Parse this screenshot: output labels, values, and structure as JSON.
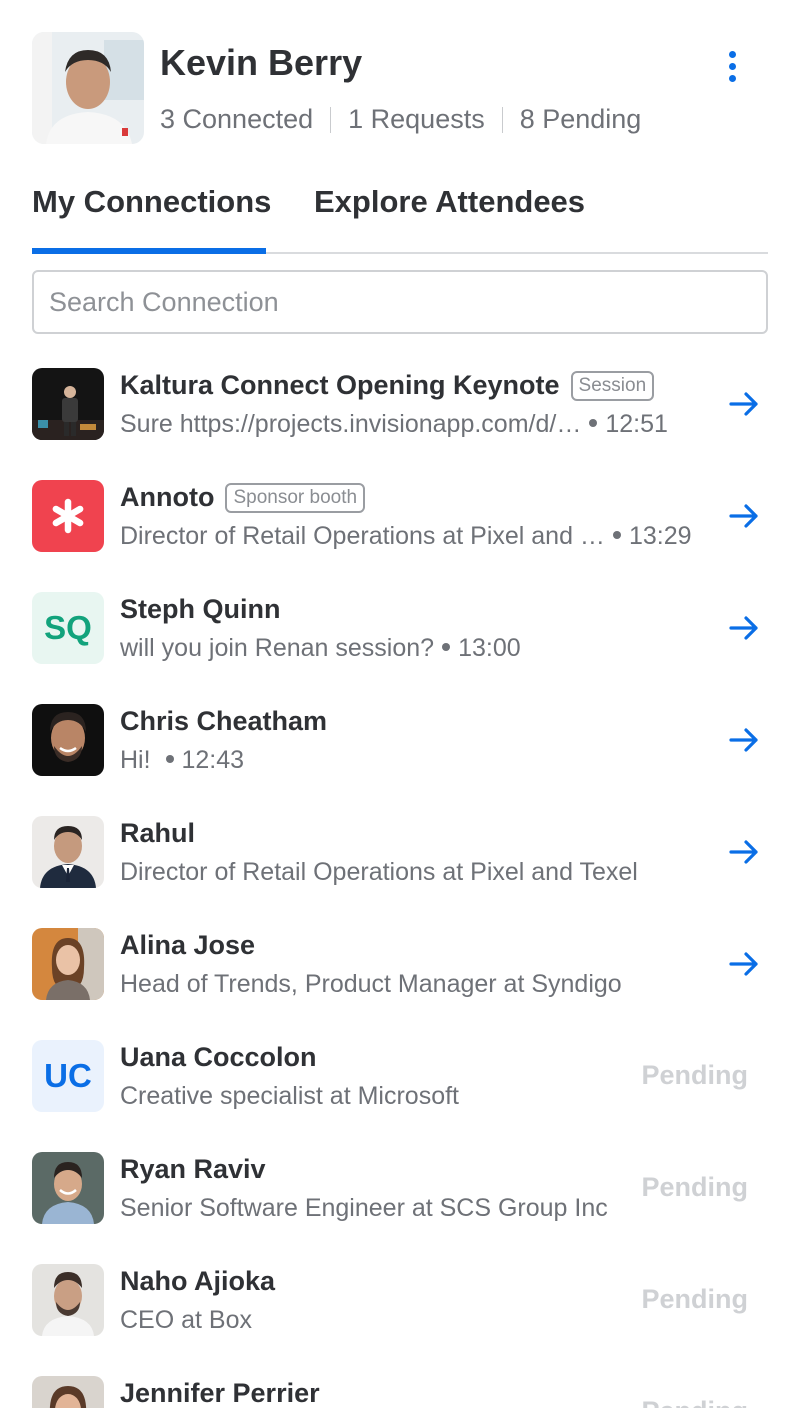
{
  "profile": {
    "name": "Kevin Berry",
    "stats": [
      "3 Connected",
      "1 Requests",
      "8 Pending"
    ]
  },
  "tabs": {
    "items": [
      "My Connections",
      "Explore Attendees"
    ],
    "active": "My Connections"
  },
  "search": {
    "placeholder": "Search Connection",
    "value": ""
  },
  "colors": {
    "accent": "#0a6ee6",
    "text": "#2f3135",
    "muted": "#6e7177",
    "pending": "#cfd1d4"
  },
  "connections": [
    {
      "name": "Kaltura Connect Opening Keynote",
      "badge": "Session",
      "subtitle": "Sure https://projects.invisionapp.com/d/…",
      "time": "12:51",
      "action": "arrow",
      "avatar": "keynote-photo"
    },
    {
      "name": "Annoto",
      "badge": "Sponsor booth",
      "subtitle": "Director of Retail Operations at Pixel and …",
      "time": "13:29",
      "action": "arrow",
      "avatar": "asterisk-logo"
    },
    {
      "name": "Steph Quinn",
      "badge": "",
      "subtitle": "will you join Renan session?",
      "time": "13:00",
      "action": "arrow",
      "initials": "SQ"
    },
    {
      "name": "Chris Cheatham",
      "badge": "",
      "subtitle": "Hi! ",
      "time": "12:43",
      "action": "arrow",
      "avatar": "person-photo"
    },
    {
      "name": "Rahul",
      "badge": "",
      "subtitle": "Director of Retail Operations at Pixel and Texel",
      "time": "",
      "action": "arrow",
      "avatar": "person-photo"
    },
    {
      "name": "Alina Jose",
      "badge": "",
      "subtitle": "Head of Trends, Product Manager at Syndigo",
      "time": "",
      "action": "arrow",
      "avatar": "person-photo"
    },
    {
      "name": "Uana Coccolon",
      "badge": "",
      "subtitle": "Creative specialist at Microsoft",
      "time": "",
      "action": "Pending",
      "initials": "UC"
    },
    {
      "name": "Ryan Raviv",
      "badge": "",
      "subtitle": "Senior Software Engineer at SCS Group Inc",
      "time": "",
      "action": "Pending",
      "avatar": "person-photo"
    },
    {
      "name": "Naho Ajioka",
      "badge": "",
      "subtitle": "CEO at Box",
      "time": "",
      "action": "Pending",
      "avatar": "person-photo"
    },
    {
      "name": "Jennifer Perrier",
      "badge": "",
      "subtitle": "",
      "time": "",
      "action": "Pending",
      "avatar": "person-photo"
    }
  ]
}
